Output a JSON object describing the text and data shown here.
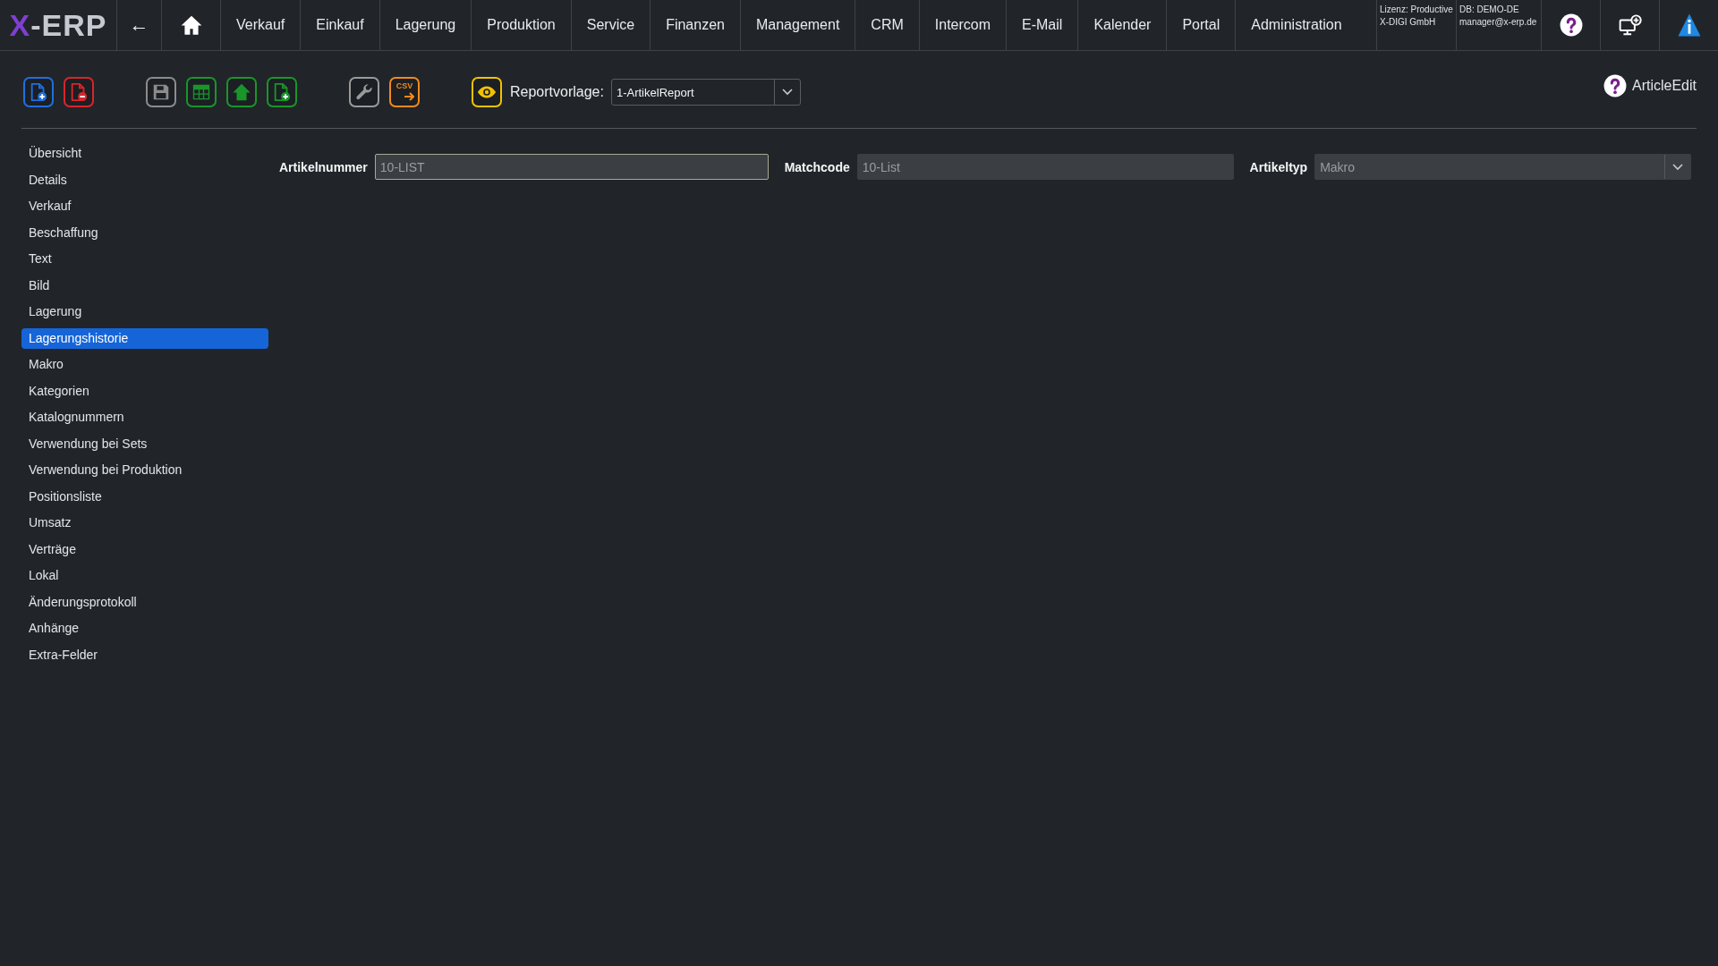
{
  "navbar": {
    "logo": "X-ERP",
    "back": "←",
    "menu": [
      "Verkauf",
      "Einkauf",
      "Lagerung",
      "Produktion",
      "Service",
      "Finanzen",
      "Management",
      "CRM",
      "Intercom",
      "E-Mail",
      "Kalender",
      "Portal",
      "Administration"
    ],
    "license": {
      "type": "Lizenz: Productive",
      "company": "X-DIGI GmbH"
    },
    "database": {
      "name": "DB: DEMO-DE",
      "user": "manager@x-erp.de"
    }
  },
  "toolbar": {
    "groups": [
      [
        {
          "kind": "new",
          "color": "#1f6fe0"
        },
        {
          "kind": "delete",
          "color": "#d9252a"
        }
      ],
      [
        {
          "kind": "save",
          "color": "#8c8c8c"
        },
        {
          "kind": "table",
          "color": "#18962a"
        },
        {
          "kind": "upload",
          "color": "#18962a"
        },
        {
          "kind": "add",
          "color": "#18962a"
        }
      ],
      [
        {
          "kind": "settings",
          "color": "#9a9a9a"
        },
        {
          "kind": "csv",
          "color": "#f08a1c",
          "label": "CSV"
        }
      ]
    ],
    "report": {
      "preview": {
        "kind": "preview",
        "color": "#f2c200"
      },
      "label": "Reportvorlage:",
      "value": "1-ArtikelReport"
    },
    "help": {
      "label": "ArticleEdit"
    }
  },
  "sidebar": {
    "items": [
      {
        "label": "Übersicht",
        "selected": false
      },
      {
        "label": "Details",
        "selected": false
      },
      {
        "label": "Verkauf",
        "selected": false
      },
      {
        "label": "Beschaffung",
        "selected": false
      },
      {
        "label": "Text",
        "selected": false
      },
      {
        "label": "Bild",
        "selected": false
      },
      {
        "label": "Lagerung",
        "selected": false
      },
      {
        "label": "Lagerungshistorie",
        "selected": true
      },
      {
        "label": "Makro",
        "selected": false
      },
      {
        "label": "Kategorien",
        "selected": false
      },
      {
        "label": "Katalognummern",
        "selected": false
      },
      {
        "label": "Verwendung bei Sets",
        "selected": false
      },
      {
        "label": "Verwendung bei Produktion",
        "selected": false
      },
      {
        "label": "Positionsliste",
        "selected": false
      },
      {
        "label": "Umsatz",
        "selected": false
      },
      {
        "label": "Verträge",
        "selected": false
      },
      {
        "label": "Lokal",
        "selected": false
      },
      {
        "label": "Änderungsprotokoll",
        "selected": false
      },
      {
        "label": "Anhänge",
        "selected": false
      },
      {
        "label": "Extra-Felder",
        "selected": false
      }
    ]
  },
  "form": {
    "fields": [
      {
        "kind": "input",
        "label": "Artikelnummer",
        "value": "10-LIST",
        "focused": true
      },
      {
        "kind": "input",
        "label": "Matchcode",
        "value": "10-List",
        "focused": false
      },
      {
        "kind": "select",
        "label": "Artikeltyp",
        "value": "Makro",
        "focused": false
      }
    ]
  }
}
